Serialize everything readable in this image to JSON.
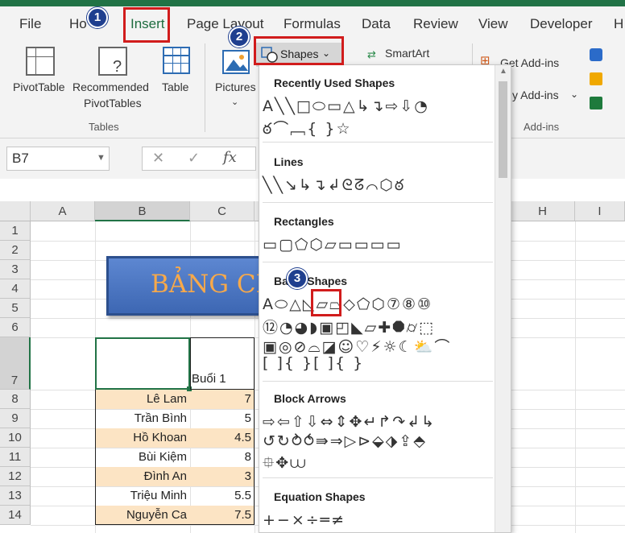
{
  "ribbon_tabs": [
    "File",
    "Ho",
    "Insert",
    "Page Layout",
    "Formulas",
    "Data",
    "Review",
    "View",
    "Developer",
    "H"
  ],
  "tables_group": {
    "pivottable": "PivotTable",
    "recommended_line1": "Recommended",
    "recommended_line2": "PivotTables",
    "table": "Table",
    "group_label": "Tables"
  },
  "illustrations": {
    "pictures": "Pictures",
    "shapes": "Shapes",
    "smartart": "SmartArt"
  },
  "addins": {
    "get": "Get Add-ins",
    "my": "y Add-ins",
    "group_label": "Add-ins"
  },
  "formula_bar": {
    "name_box": "B7"
  },
  "columns": [
    "A",
    "B",
    "C",
    "H",
    "I"
  ],
  "rows": [
    "1",
    "2",
    "3",
    "4",
    "5",
    "6",
    "7",
    "8",
    "9",
    "10",
    "11",
    "12",
    "13",
    "14"
  ],
  "sheet": {
    "banner_text": "BẢNG CH",
    "header_c7": "Buổi 1",
    "names": [
      "Lê Lam",
      "Trần Bình",
      "Hồ Khoan",
      "Bùi Kiệm",
      "Đình An",
      "Triệu Minh",
      "Nguyễn Ca"
    ],
    "values": [
      "7",
      "5",
      "4.5",
      "8",
      "3",
      "5.5",
      "7.5"
    ]
  },
  "shapes_menu": {
    "recently_used": "Recently Used Shapes",
    "lines": "Lines",
    "rectangles": "Rectangles",
    "basic_shapes": "Basic Shapes",
    "block_arrows": "Block Arrows",
    "equation_shapes": "Equation Shapes",
    "recent_row1": "A╲╲□⬭▭△↳↴⇨⇩◔",
    "recent_row2": "ఠ⌒﹇{ }☆",
    "lines_row": "╲╲↘↳↴↲ᘓᘔ⌒⬡ఠ",
    "rect_row": "▭▢⬠⬡▱▭▭▭▭",
    "basic_row1": "A⬭△◺▱⏢◇⬠⬡⑦⑧⑩",
    "basic_row2": "⑫◔◕◗▣◰◣▱✚⯃⌭⬚",
    "basic_row3": "▣◎⊘⌓◪☺♡⚡☼☾⛅⌒",
    "basic_row4": "[ ]{ }[ ]{ }",
    "arrow_row1": "⇨⇦⇧⇩⇔⇕✥↵↱↷↲↳",
    "arrow_row2": "↺↻⥁⥀⇛⇒▷⊳⬙⬗⇪⬘",
    "arrow_row3": "⯐✥⩊",
    "eq_row": "+−×÷═≠"
  },
  "badges": [
    "1",
    "2",
    "3"
  ]
}
